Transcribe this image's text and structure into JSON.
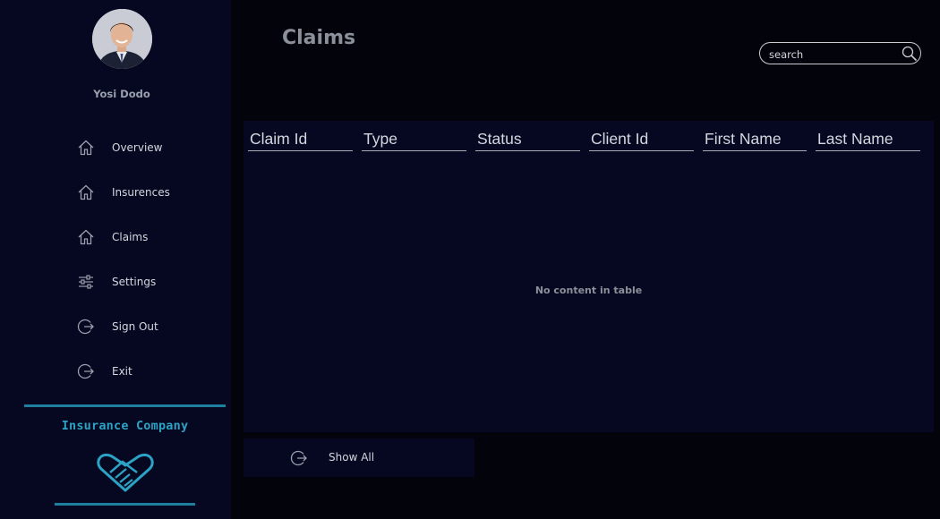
{
  "user": {
    "name": "Yosi Dodo"
  },
  "sidebar": {
    "items": [
      {
        "label": "Overview",
        "icon": "home-icon"
      },
      {
        "label": "Insurences",
        "icon": "home-icon"
      },
      {
        "label": "Claims",
        "icon": "home-icon"
      },
      {
        "label": "Settings",
        "icon": "sliders-icon"
      },
      {
        "label": "Sign Out",
        "icon": "logout-icon"
      },
      {
        "label": "Exit",
        "icon": "logout-icon"
      }
    ],
    "brand": "Insurance Company"
  },
  "main": {
    "title": "Claims",
    "search": {
      "placeholder": "search",
      "value": ""
    },
    "table": {
      "columns": [
        "Claim Id",
        "Type",
        "Status",
        "Client Id",
        "First Name",
        "Last Name"
      ],
      "rows": [],
      "empty_message": "No content in table"
    },
    "show_all_label": "Show All"
  },
  "colors": {
    "sidebar_bg": "#050820",
    "page_bg": "#03030c",
    "accent": "#1f7f9f",
    "brand_text": "#2ca3c4"
  }
}
